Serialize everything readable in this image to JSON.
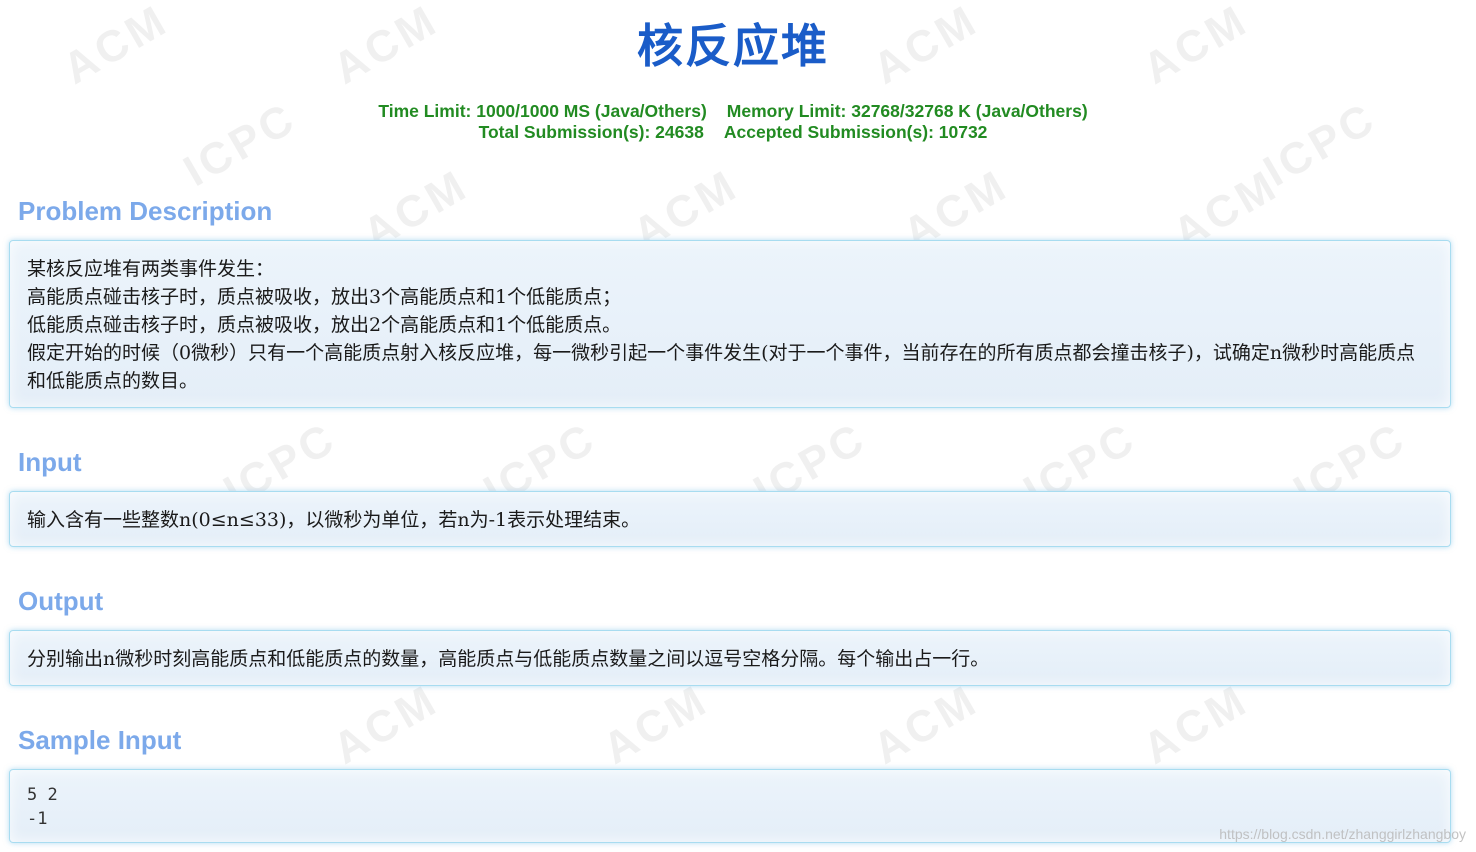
{
  "problem": {
    "title": "核反应堆",
    "time_limit": "Time Limit: 1000/1000 MS (Java/Others)",
    "memory_limit": "Memory Limit: 32768/32768 K (Java/Others)",
    "total_submissions": "Total Submission(s): 24638",
    "accepted_submissions": "Accepted Submission(s): 10732"
  },
  "sections": {
    "description": {
      "heading": "Problem Description",
      "lines": [
        "某核反应堆有两类事件发生：",
        "高能质点碰击核子时，质点被吸收，放出3个高能质点和1个低能质点；",
        "低能质点碰击核子时，质点被吸收，放出2个高能质点和1个低能质点。",
        "假定开始的时候（0微秒）只有一个高能质点射入核反应堆，每一微秒引起一个事件发生(对于一个事件，当前存在的所有质点都会撞击核子)，试确定n微秒时高能质点和低能质点的数目。"
      ]
    },
    "input": {
      "heading": "Input",
      "text": "输入含有一些整数n(0≤n≤33)，以微秒为单位，若n为-1表示处理结束。"
    },
    "output": {
      "heading": "Output",
      "text": "分别输出n微秒时刻高能质点和低能质点的数量，高能质点与低能质点数量之间以逗号空格分隔。每个输出占一行。"
    },
    "sample_input": {
      "heading": "Sample Input",
      "lines": [
        "5 2",
        "-1"
      ]
    }
  },
  "watermark": {
    "acm": "ACM",
    "icpc": "ICPC",
    "credit": "https://blog.csdn.net/zhanggirlzhangboy"
  }
}
